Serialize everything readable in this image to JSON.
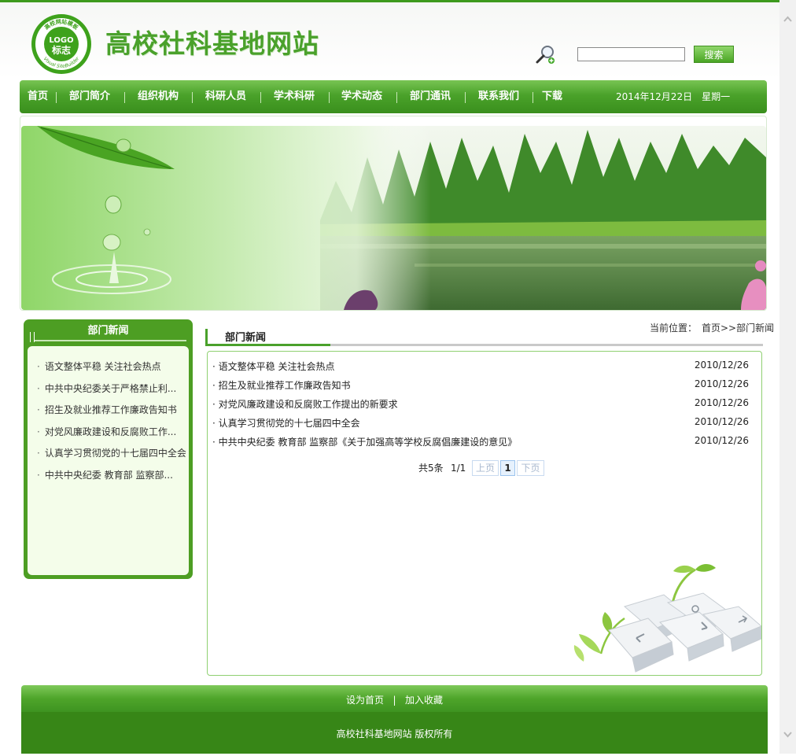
{
  "header": {
    "site_title": "高校社科基地网站",
    "logo": {
      "top_arc": "高校网站模板",
      "center": "LOGO",
      "sub": "标志",
      "bottom_arc": "Visual SiteBuilder"
    },
    "search_button": "搜索",
    "search_value": ""
  },
  "nav": {
    "items": [
      {
        "label": "首页"
      },
      {
        "label": "部门简介"
      },
      {
        "label": "组织机构"
      },
      {
        "label": "科研人员"
      },
      {
        "label": "学术科研"
      },
      {
        "label": "学术动态"
      },
      {
        "label": "部门通讯"
      },
      {
        "label": "联系我们"
      },
      {
        "label": "下载"
      }
    ],
    "date": "2014年12月22日　星期一"
  },
  "sidebar": {
    "title": "部门新闻",
    "items": [
      {
        "label": "语文整体平稳 关注社会热点"
      },
      {
        "label": "中共中央纪委关于严格禁止利..."
      },
      {
        "label": "招生及就业推荐工作廉政告知书"
      },
      {
        "label": "对党风廉政建设和反腐败工作..."
      },
      {
        "label": "认真学习贯彻党的十七届四中全会"
      },
      {
        "label": "中共中央纪委 教育部 监察部..."
      }
    ]
  },
  "main": {
    "breadcrumb": "当前位置：　首页>>部门新闻",
    "section_title": "部门新闻",
    "news": [
      {
        "title": "语文整体平稳 关注社会热点",
        "date": "2010/12/26"
      },
      {
        "title": "招生及就业推荐工作廉政告知书",
        "date": "2010/12/26"
      },
      {
        "title": "对党风廉政建设和反腐败工作提出的新要求",
        "date": "2010/12/26"
      },
      {
        "title": "认真学习贯彻党的十七届四中全会",
        "date": "2010/12/26"
      },
      {
        "title": "中共中央纪委 教育部 监察部《关于加强高等学校反腐倡廉建设的意见》",
        "date": "2010/12/26"
      }
    ],
    "pager": {
      "total": "共5条",
      "page_of": "1/1",
      "prev": "上页",
      "current": "1",
      "next": "下页"
    }
  },
  "footer": {
    "set_home": "设为首页",
    "separator": "|",
    "add_fav": "加入收藏",
    "copyright": "高校社科基地网站 版权所有"
  },
  "colors": {
    "brand_green": "#4aa12b",
    "nav_green": "#4aa22a",
    "footer_dark": "#378617"
  }
}
